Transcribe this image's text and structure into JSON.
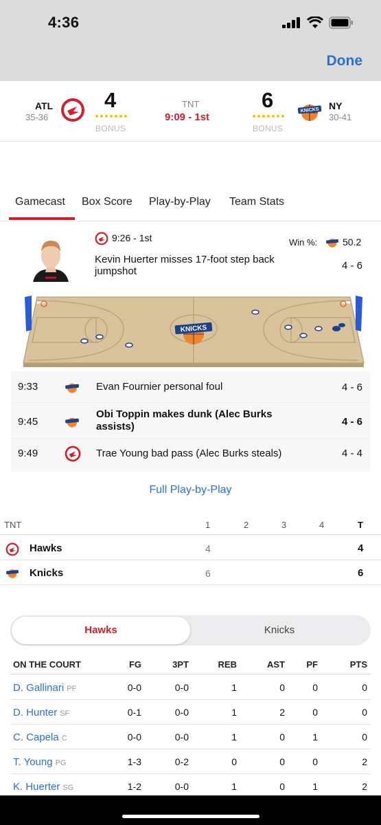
{
  "status_bar": {
    "time": "4:36"
  },
  "nav": {
    "done_label": "Done"
  },
  "scoreboard": {
    "away": {
      "abbr": "ATL",
      "record": "35-36",
      "score": "4",
      "bonus_label": "BONUS"
    },
    "home": {
      "abbr": "NY",
      "record": "30-41",
      "score": "6",
      "bonus_label": "BONUS"
    },
    "network": "TNT",
    "clock": "9:09 - 1st"
  },
  "tabs": [
    "Gamecast",
    "Box Score",
    "Play-by-Play",
    "Team Stats"
  ],
  "last_play": {
    "time": "9:26 - 1st",
    "win_label": "Win %:",
    "win_value": "50.2",
    "text": "Kevin Huerter misses 17-foot step back jumpshot",
    "score": "4 - 6"
  },
  "plays": [
    {
      "time": "9:33",
      "team_icon": "knicks-logo-icon",
      "text": "Evan Fournier personal foul",
      "score": "4 - 6",
      "bold": false
    },
    {
      "time": "9:45",
      "team_icon": "knicks-logo-icon",
      "text": "Obi Toppin makes dunk (Alec Burks assists)",
      "score": "4 - 6",
      "bold": true
    },
    {
      "time": "9:49",
      "team_icon": "hawks-logo-icon",
      "text": "Trae Young bad pass (Alec Burks steals)",
      "score": "4 - 4",
      "bold": false
    }
  ],
  "full_pbp_label": "Full Play-by-Play",
  "linescore": {
    "network": "TNT",
    "periods": [
      "1",
      "2",
      "3",
      "4"
    ],
    "total_label": "T",
    "teams": [
      {
        "name": "Hawks",
        "icon": "hawks-logo-icon",
        "q1": "4",
        "total": "4"
      },
      {
        "name": "Knicks",
        "icon": "knicks-logo-icon",
        "q1": "6",
        "total": "6"
      }
    ]
  },
  "team_toggle": {
    "left": "Hawks",
    "right": "Knicks",
    "selected": "Hawks"
  },
  "player_table": {
    "headers": [
      "ON THE COURT",
      "FG",
      "3PT",
      "REB",
      "AST",
      "PF",
      "PTS"
    ],
    "rows": [
      {
        "name": "D. Gallinari",
        "pos": "PF",
        "fg": "0-0",
        "tp": "0-0",
        "reb": "1",
        "ast": "0",
        "pf": "0",
        "pts": "0"
      },
      {
        "name": "D. Hunter",
        "pos": "SF",
        "fg": "0-1",
        "tp": "0-0",
        "reb": "1",
        "ast": "2",
        "pf": "0",
        "pts": "0"
      },
      {
        "name": "C. Capela",
        "pos": "C",
        "fg": "0-0",
        "tp": "0-0",
        "reb": "1",
        "ast": "0",
        "pf": "1",
        "pts": "0"
      },
      {
        "name": "T. Young",
        "pos": "PG",
        "fg": "1-3",
        "tp": "0-2",
        "reb": "0",
        "ast": "0",
        "pf": "0",
        "pts": "2"
      },
      {
        "name": "K. Huerter",
        "pos": "SG",
        "fg": "1-2",
        "tp": "0-0",
        "reb": "1",
        "ast": "0",
        "pf": "1",
        "pts": "2"
      }
    ]
  },
  "colors": {
    "accent_red": "#d0202a",
    "link_blue": "#2d6fcf",
    "bonus_yellow": "#f2c300"
  }
}
